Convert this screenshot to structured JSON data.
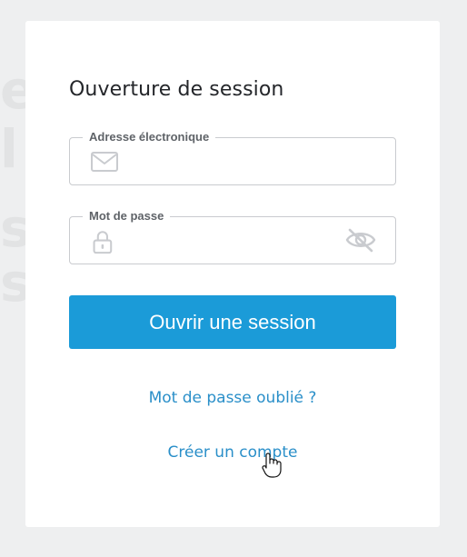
{
  "login": {
    "title": "Ouverture de session",
    "email_label": "Adresse électronique",
    "email_value": "",
    "password_label": "Mot de passe",
    "password_value": "",
    "submit_label": "Ouvrir une session",
    "forgot_link": "Mot de passe oublié ?",
    "create_link": "Créer un compte"
  },
  "icons": {
    "email": "mail-icon",
    "password": "lock-icon",
    "toggle": "eye-slash-icon",
    "cursor": "hand-pointer-cursor"
  },
  "colors": {
    "accent": "#1b9bd8",
    "link": "#2a8fc9",
    "icon": "#c9cbcf",
    "background": "#eeeff0"
  }
}
